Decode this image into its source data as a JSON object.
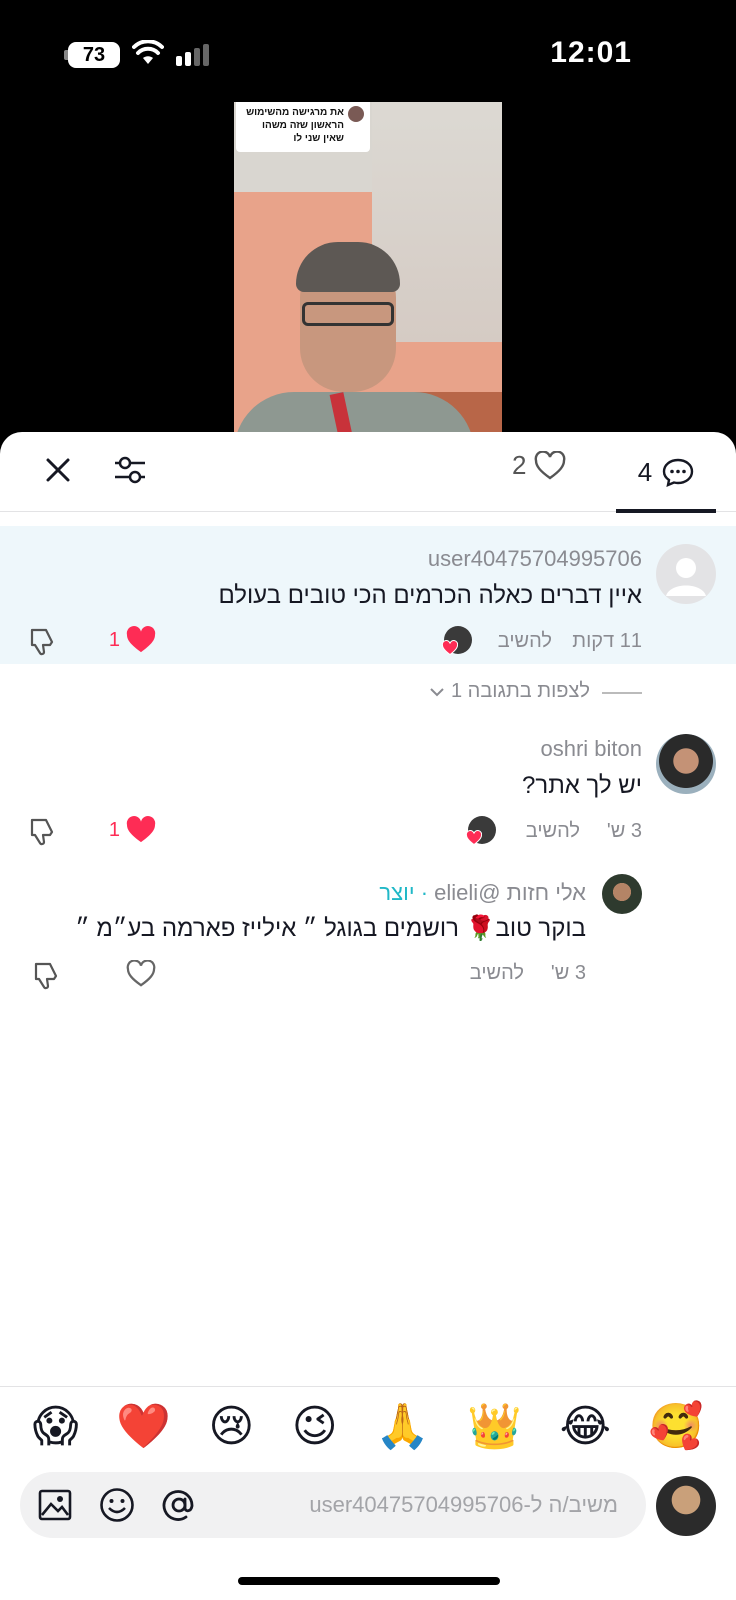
{
  "status_bar": {
    "battery": "73",
    "time": "12:01"
  },
  "video": {
    "caption": "את מרגישה מהשימוש הראשון שזה משהו שאין שני לו"
  },
  "header": {
    "likes_count": "2",
    "comments_count": "4"
  },
  "comments": [
    {
      "username": "user40475704995706",
      "text": "איין דברים כאלה הכרמים הכי טובים בעולם",
      "time": "11 דקות",
      "reply_label": "להשיב",
      "like_count": "1",
      "liked": true
    },
    {
      "username": "oshri biton",
      "text": "יש לך אתר?",
      "time": "3 ש'",
      "reply_label": "להשיב",
      "like_count": "1",
      "liked": true
    },
    {
      "username": "אלי חזות @elieli",
      "creator_label": "· יוצר",
      "text": "בוקר טוב🌹 רושמים בגוגל ״ אילייז פארמה בע״מ ״",
      "time": "3 ש'",
      "reply_label": "להשיב",
      "liked": false
    }
  ],
  "view_replies": "לצפות בתגובה 1",
  "emoji_bar": [
    "😱",
    "❤️",
    "😢",
    "😉",
    "🙏",
    "👑",
    "😂",
    "🥰"
  ],
  "input": {
    "placeholder": "משיב/ה ל-user40475704995706"
  },
  "colors": {
    "like_red": "#fe2c55",
    "creator_teal": "#20b8c7",
    "highlight_bg": "#eef7fb"
  }
}
